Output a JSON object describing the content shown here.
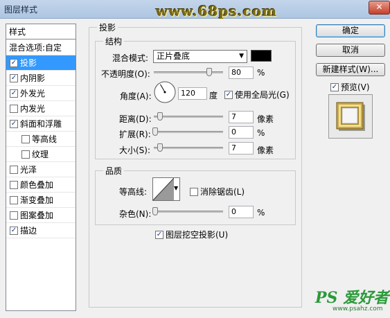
{
  "window": {
    "title": "图层样式",
    "watermark": "www.68ps.com",
    "close_icon": "close-icon"
  },
  "style_list": {
    "header": "样式",
    "blend_options": "混合选项:自定",
    "items": [
      {
        "label": "投影",
        "checked": true,
        "selected": true,
        "indent": false
      },
      {
        "label": "内阴影",
        "checked": true,
        "selected": false,
        "indent": false
      },
      {
        "label": "外发光",
        "checked": true,
        "selected": false,
        "indent": false
      },
      {
        "label": "内发光",
        "checked": false,
        "selected": false,
        "indent": false
      },
      {
        "label": "斜面和浮雕",
        "checked": true,
        "selected": false,
        "indent": false
      },
      {
        "label": "等高线",
        "checked": false,
        "selected": false,
        "indent": true
      },
      {
        "label": "纹理",
        "checked": false,
        "selected": false,
        "indent": true
      },
      {
        "label": "光泽",
        "checked": false,
        "selected": false,
        "indent": false
      },
      {
        "label": "颜色叠加",
        "checked": false,
        "selected": false,
        "indent": false
      },
      {
        "label": "渐变叠加",
        "checked": false,
        "selected": false,
        "indent": false
      },
      {
        "label": "图案叠加",
        "checked": false,
        "selected": false,
        "indent": false
      },
      {
        "label": "描边",
        "checked": true,
        "selected": false,
        "indent": false
      }
    ]
  },
  "drop_shadow": {
    "section_title": "投影",
    "structure": {
      "title": "结构",
      "blend_mode_label": "混合模式:",
      "blend_mode_value": "正片叠底",
      "shadow_color": "#000000",
      "opacity_label": "不透明度(O):",
      "opacity_value": "80",
      "opacity_fraction": 0.8,
      "percent": "%",
      "angle_label": "角度(A):",
      "angle_value": "120",
      "degree_unit": "度",
      "global_light_label": "使用全局光(G)",
      "global_light_checked": true,
      "distance_label": "距离(D):",
      "distance_value": "7",
      "px_unit": "像素",
      "spread_label": "扩展(R):",
      "spread_value": "0",
      "size_label": "大小(S):",
      "size_value": "7"
    },
    "quality": {
      "title": "品质",
      "contour_label": "等高线:",
      "anti_alias_label": "消除锯齿(L)",
      "anti_alias_checked": false,
      "noise_label": "杂色(N):",
      "noise_value": "0",
      "percent": "%"
    },
    "knockout_label": "图层挖空投影(U)",
    "knockout_checked": true
  },
  "buttons": {
    "ok": "确定",
    "cancel": "取消",
    "new_style": "新建样式(W)...",
    "preview_label": "预览(V)",
    "preview_checked": true
  },
  "branding": {
    "logo": "PS 爱好者",
    "site": "www.psahz.com"
  },
  "colors": {
    "selection": "#3399ff",
    "shadow_color": "#000000"
  }
}
